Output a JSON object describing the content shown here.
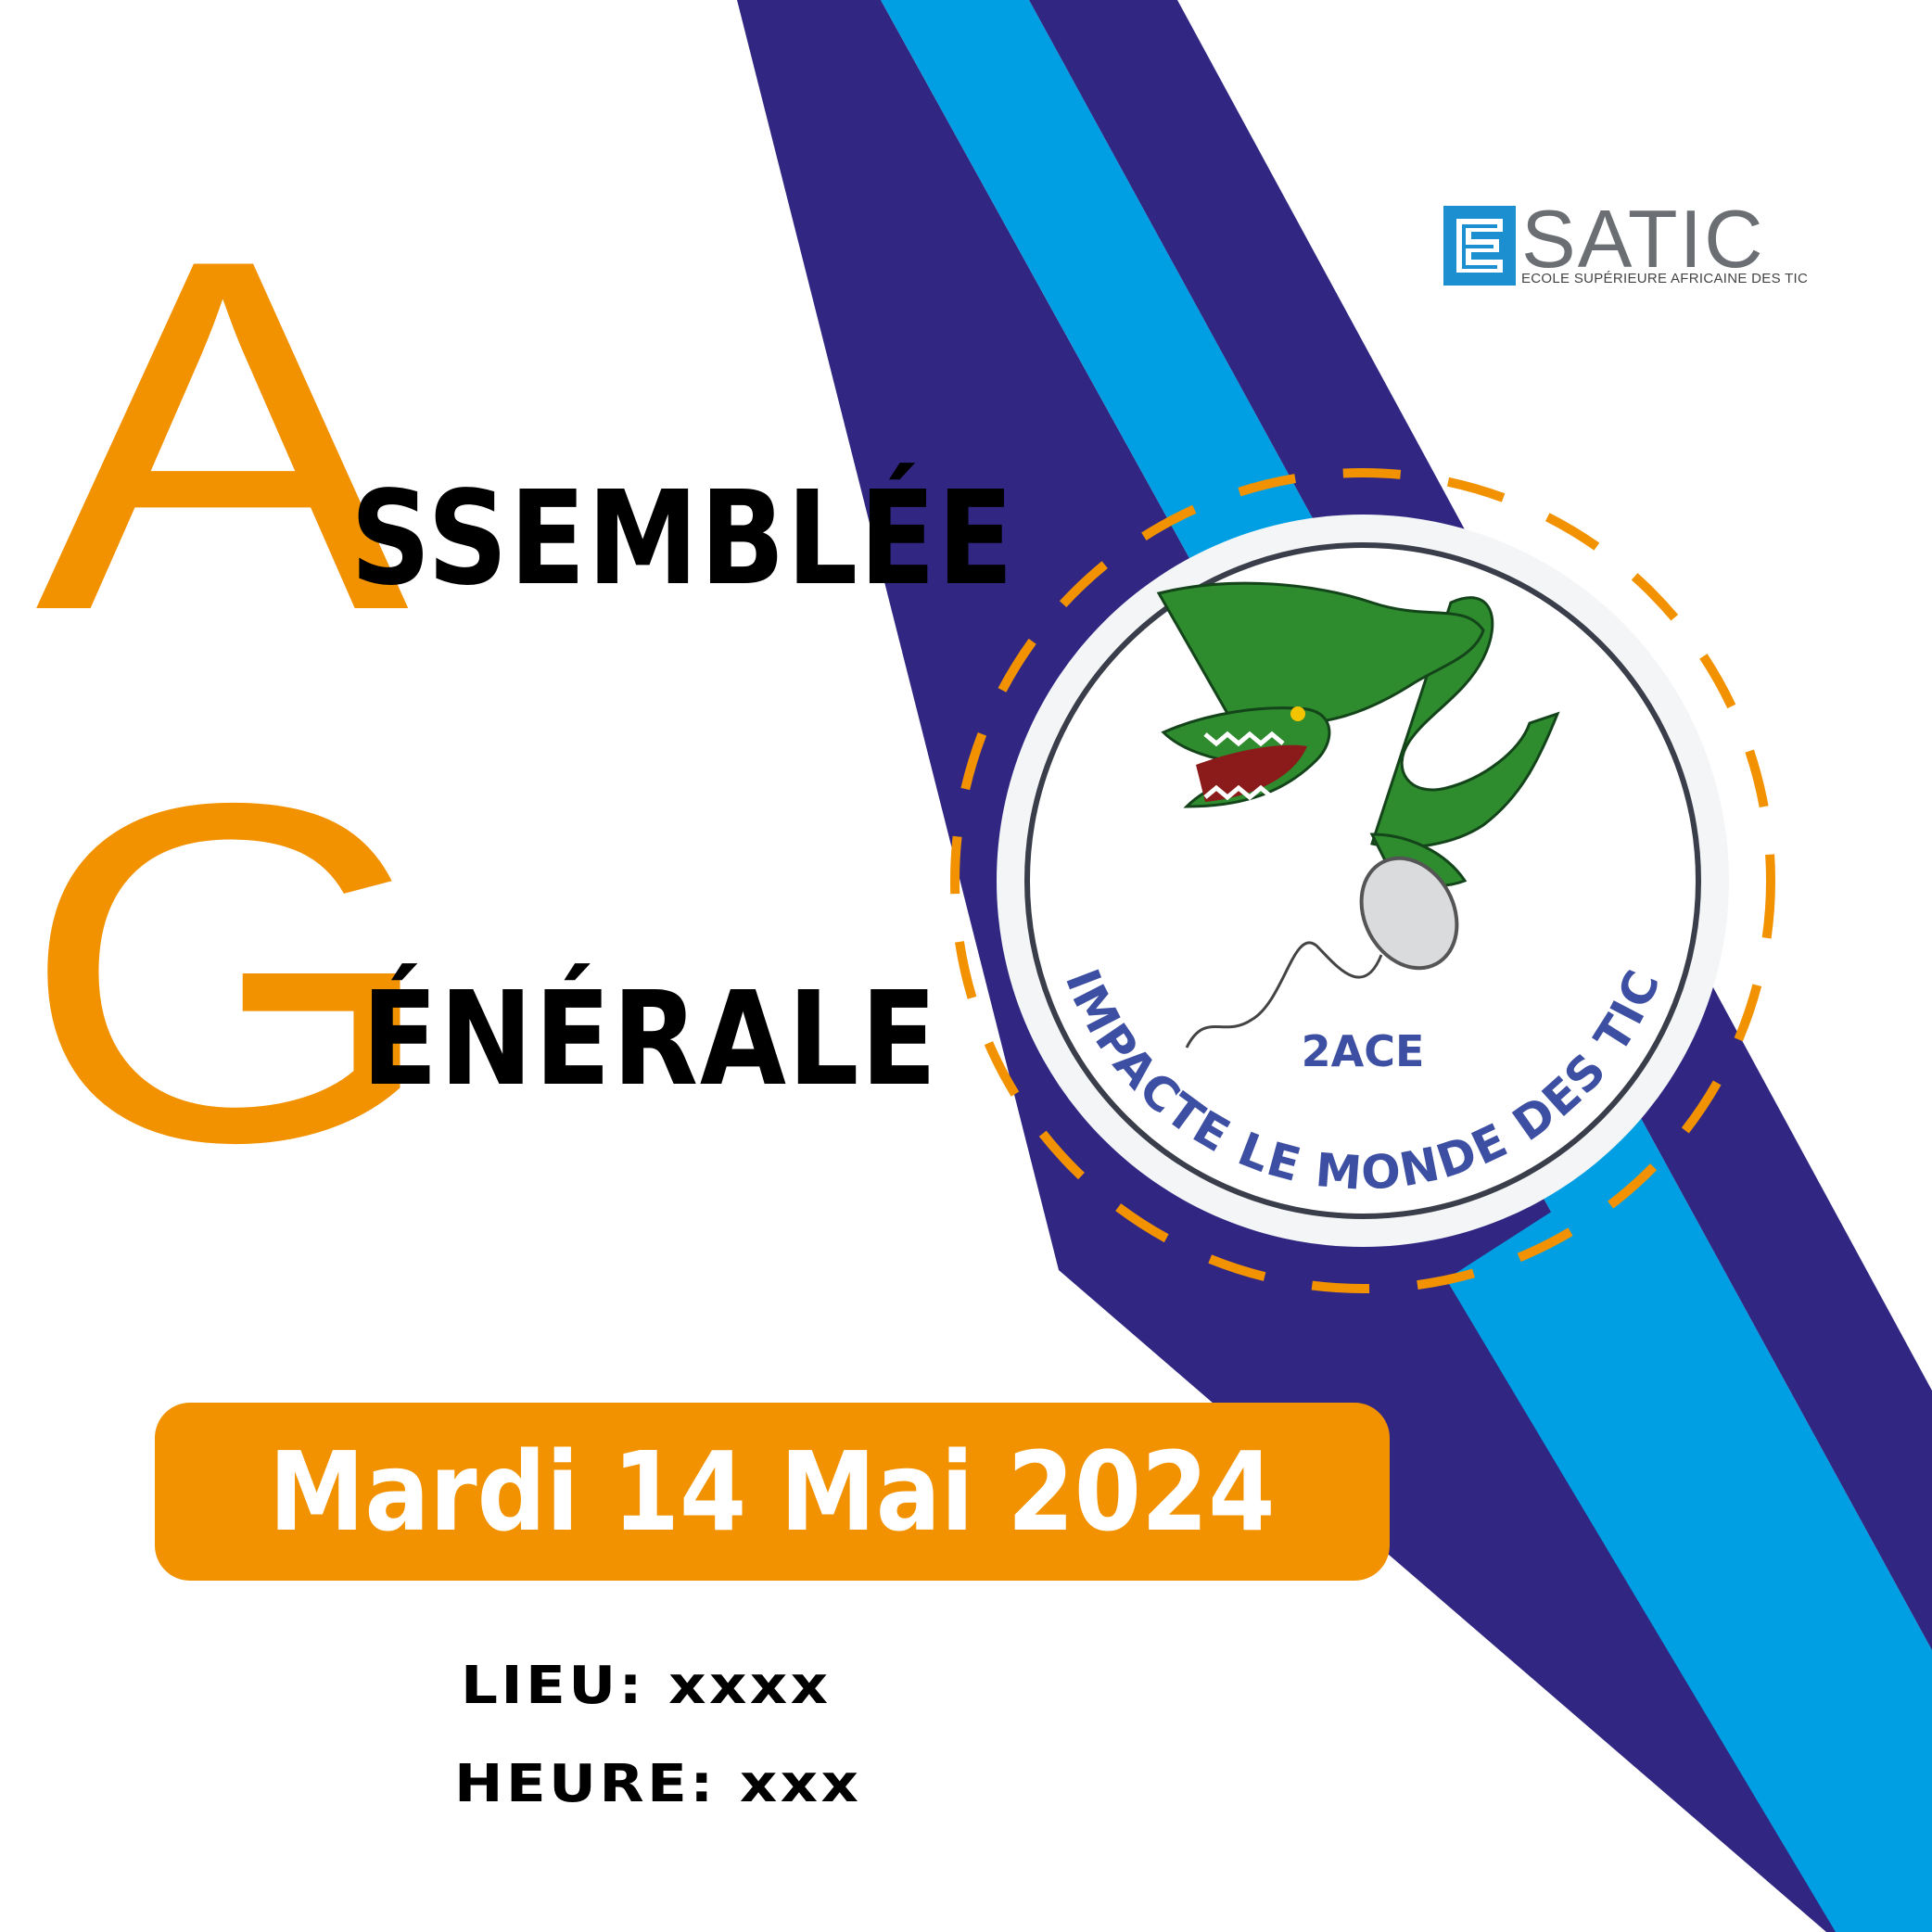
{
  "poster": {
    "title_line_1": {
      "initial": "A",
      "rest": "SSEMBLÉE"
    },
    "title_line_2": {
      "initial": "G",
      "rest": "ÉNÉRALE"
    },
    "date": "Mardi 14 Mai 2024",
    "location": "LIEU: xxxx",
    "time": "HEURE: xxx"
  },
  "school_logo": {
    "letters": "SATIC",
    "tagline": "ECOLE SUPÉRIEURE AFRICAINE DES TIC"
  },
  "emblem": {
    "center_text": "2ACE",
    "arc_text": "IMPACTE LE MONDE DES TIC",
    "mascot": "crocodile-with-mouse-icon"
  },
  "colors": {
    "accent_orange": "#F29200",
    "stripe_navy": "#312782",
    "stripe_blue": "#009FE3",
    "emblem_text_blue": "#3D4FA2",
    "logo_blue": "#1B8FCF"
  }
}
